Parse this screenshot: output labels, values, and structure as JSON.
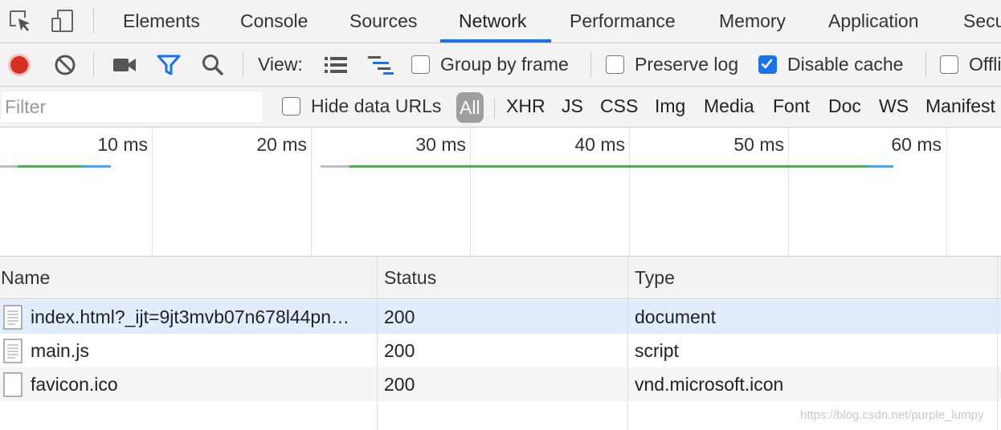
{
  "tabs": {
    "inspect_icon": "element-picker-icon",
    "device_icon": "device-toolbar-icon",
    "items": [
      "Elements",
      "Console",
      "Sources",
      "Network",
      "Performance",
      "Memory",
      "Application",
      "Secu"
    ],
    "active": "Network"
  },
  "toolbar": {
    "record_icon": "record-icon",
    "clear_icon": "clear-icon",
    "screenshot_icon": "video-camera-icon",
    "filter_icon": "filter-icon",
    "search_icon": "search-icon",
    "view_label": "View:",
    "view_list_icon": "large-rows-icon",
    "view_waterfall_icon": "waterfall-icon",
    "group_by_frame": "Group by frame",
    "preserve_log": "Preserve log",
    "disable_cache": "Disable cache",
    "offline": "Offli",
    "disable_cache_checked": true,
    "accent_color": "#1a73e8",
    "record_color": "#d93025"
  },
  "filter": {
    "placeholder": "Filter",
    "hide_data_urls": "Hide data URLs",
    "types": [
      "All",
      "XHR",
      "JS",
      "CSS",
      "Img",
      "Media",
      "Font",
      "Doc",
      "WS",
      "Manifest"
    ],
    "active_type": "All"
  },
  "overview": {
    "ticks": [
      "10 ms",
      "20 ms",
      "30 ms",
      "40 ms",
      "50 ms",
      "60 ms"
    ],
    "colors": {
      "waiting": "#bdbdbd",
      "download": "#4caf50",
      "receive": "#42a5f5"
    }
  },
  "table": {
    "columns": [
      "Name",
      "Status",
      "Type"
    ],
    "rows": [
      {
        "name": "index.html?_ijt=9jt3mvb07n678l44pn…",
        "status": "200",
        "type": "document",
        "icon": "document-file-icon"
      },
      {
        "name": "main.js",
        "status": "200",
        "type": "script",
        "icon": "script-file-icon"
      },
      {
        "name": "favicon.ico",
        "status": "200",
        "type": "vnd.microsoft.icon",
        "icon": "blank-file-icon"
      }
    ]
  },
  "watermark": "https://blog.csdn.net/purple_lumpy"
}
